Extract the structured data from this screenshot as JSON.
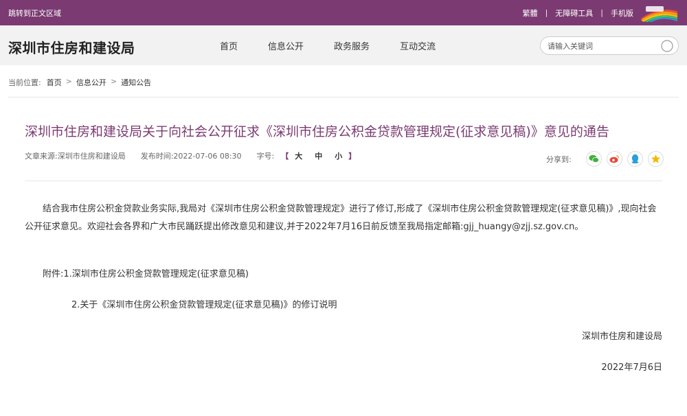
{
  "topbar": {
    "skip_link": "跳转到正文区域",
    "traditional": "繁體",
    "accessibility": "无障碍工具",
    "mobile": "手机版",
    "separator": "|",
    "color": "#7b3b72"
  },
  "header": {
    "site_title": "深圳市住房和建设局",
    "nav": [
      "首页",
      "信息公开",
      "政务服务",
      "互动交流"
    ],
    "search_placeholder": "请输入关键词",
    "search_icon": "search-icon"
  },
  "breadcrumb": {
    "label": "当前位置:",
    "items": [
      "首页",
      "信息公开",
      "通知公告"
    ],
    "arrow": ">"
  },
  "article": {
    "title": "深圳市住房和建设局关于向社会公开征求《深圳市住房公积金贷款管理规定(征求意见稿)》意见的通告",
    "title_color": "#7b3b72",
    "source": "文章来源:深圳市住房和建设局",
    "publish_time": "发布时间:2022-07-06 08:30",
    "font_size_label": "字号:",
    "font_bracket_open": "【",
    "font_bracket_close": "】",
    "font_sizes": [
      "大",
      "中",
      "小"
    ],
    "share_label": "分享到:",
    "share_icons": [
      "wechat-icon",
      "weibo-icon",
      "qq-icon",
      "qzone-icon"
    ],
    "paragraph": "结合我市住房公积金贷款业务实际,我局对《深圳市住房公积金贷款管理规定》进行了修订,形成了《深圳市住房公积金贷款管理规定(征求意见稿)》,现向社会公开征求意见。欢迎社会各界和广大市民踊跃提出修改意见和建议,并于2022年7月16日前反馈至我局指定邮箱:gjj_huangy@zjj.sz.gov.cn。",
    "attachment_1": "附件:1.深圳市住房公积金贷款管理规定(征求意见稿)",
    "attachment_2": "2.关于《深圳市住房公积金贷款管理规定(征求意见稿)》的修订说明",
    "signature_org": "深圳市住房和建设局",
    "signature_date": "2022年7月6日"
  }
}
